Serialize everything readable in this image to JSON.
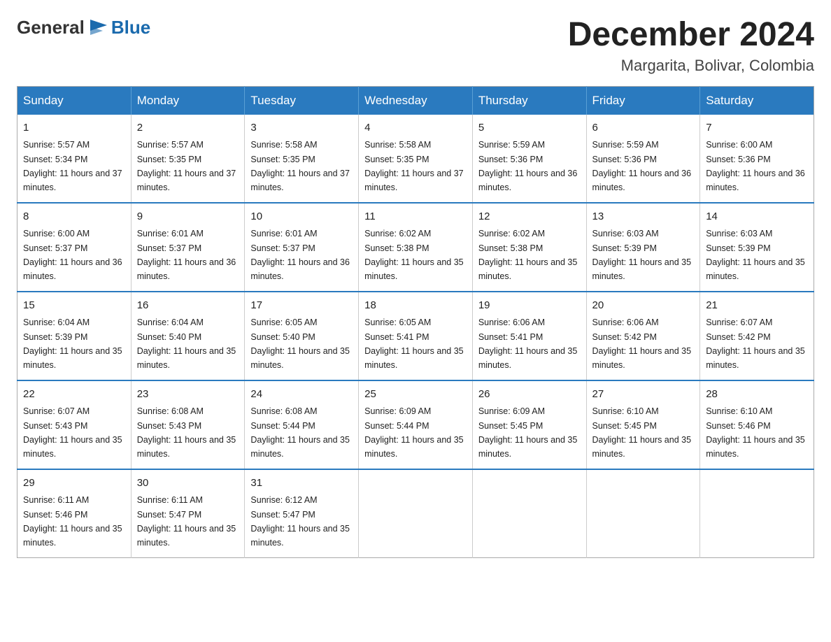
{
  "header": {
    "logo_general": "General",
    "logo_blue": "Blue",
    "month_title": "December 2024",
    "location": "Margarita, Bolivar, Colombia"
  },
  "days_of_week": [
    "Sunday",
    "Monday",
    "Tuesday",
    "Wednesday",
    "Thursday",
    "Friday",
    "Saturday"
  ],
  "weeks": [
    [
      {
        "num": "1",
        "sunrise": "5:57 AM",
        "sunset": "5:34 PM",
        "daylight": "11 hours and 37 minutes."
      },
      {
        "num": "2",
        "sunrise": "5:57 AM",
        "sunset": "5:35 PM",
        "daylight": "11 hours and 37 minutes."
      },
      {
        "num": "3",
        "sunrise": "5:58 AM",
        "sunset": "5:35 PM",
        "daylight": "11 hours and 37 minutes."
      },
      {
        "num": "4",
        "sunrise": "5:58 AM",
        "sunset": "5:35 PM",
        "daylight": "11 hours and 37 minutes."
      },
      {
        "num": "5",
        "sunrise": "5:59 AM",
        "sunset": "5:36 PM",
        "daylight": "11 hours and 36 minutes."
      },
      {
        "num": "6",
        "sunrise": "5:59 AM",
        "sunset": "5:36 PM",
        "daylight": "11 hours and 36 minutes."
      },
      {
        "num": "7",
        "sunrise": "6:00 AM",
        "sunset": "5:36 PM",
        "daylight": "11 hours and 36 minutes."
      }
    ],
    [
      {
        "num": "8",
        "sunrise": "6:00 AM",
        "sunset": "5:37 PM",
        "daylight": "11 hours and 36 minutes."
      },
      {
        "num": "9",
        "sunrise": "6:01 AM",
        "sunset": "5:37 PM",
        "daylight": "11 hours and 36 minutes."
      },
      {
        "num": "10",
        "sunrise": "6:01 AM",
        "sunset": "5:37 PM",
        "daylight": "11 hours and 36 minutes."
      },
      {
        "num": "11",
        "sunrise": "6:02 AM",
        "sunset": "5:38 PM",
        "daylight": "11 hours and 35 minutes."
      },
      {
        "num": "12",
        "sunrise": "6:02 AM",
        "sunset": "5:38 PM",
        "daylight": "11 hours and 35 minutes."
      },
      {
        "num": "13",
        "sunrise": "6:03 AM",
        "sunset": "5:39 PM",
        "daylight": "11 hours and 35 minutes."
      },
      {
        "num": "14",
        "sunrise": "6:03 AM",
        "sunset": "5:39 PM",
        "daylight": "11 hours and 35 minutes."
      }
    ],
    [
      {
        "num": "15",
        "sunrise": "6:04 AM",
        "sunset": "5:39 PM",
        "daylight": "11 hours and 35 minutes."
      },
      {
        "num": "16",
        "sunrise": "6:04 AM",
        "sunset": "5:40 PM",
        "daylight": "11 hours and 35 minutes."
      },
      {
        "num": "17",
        "sunrise": "6:05 AM",
        "sunset": "5:40 PM",
        "daylight": "11 hours and 35 minutes."
      },
      {
        "num": "18",
        "sunrise": "6:05 AM",
        "sunset": "5:41 PM",
        "daylight": "11 hours and 35 minutes."
      },
      {
        "num": "19",
        "sunrise": "6:06 AM",
        "sunset": "5:41 PM",
        "daylight": "11 hours and 35 minutes."
      },
      {
        "num": "20",
        "sunrise": "6:06 AM",
        "sunset": "5:42 PM",
        "daylight": "11 hours and 35 minutes."
      },
      {
        "num": "21",
        "sunrise": "6:07 AM",
        "sunset": "5:42 PM",
        "daylight": "11 hours and 35 minutes."
      }
    ],
    [
      {
        "num": "22",
        "sunrise": "6:07 AM",
        "sunset": "5:43 PM",
        "daylight": "11 hours and 35 minutes."
      },
      {
        "num": "23",
        "sunrise": "6:08 AM",
        "sunset": "5:43 PM",
        "daylight": "11 hours and 35 minutes."
      },
      {
        "num": "24",
        "sunrise": "6:08 AM",
        "sunset": "5:44 PM",
        "daylight": "11 hours and 35 minutes."
      },
      {
        "num": "25",
        "sunrise": "6:09 AM",
        "sunset": "5:44 PM",
        "daylight": "11 hours and 35 minutes."
      },
      {
        "num": "26",
        "sunrise": "6:09 AM",
        "sunset": "5:45 PM",
        "daylight": "11 hours and 35 minutes."
      },
      {
        "num": "27",
        "sunrise": "6:10 AM",
        "sunset": "5:45 PM",
        "daylight": "11 hours and 35 minutes."
      },
      {
        "num": "28",
        "sunrise": "6:10 AM",
        "sunset": "5:46 PM",
        "daylight": "11 hours and 35 minutes."
      }
    ],
    [
      {
        "num": "29",
        "sunrise": "6:11 AM",
        "sunset": "5:46 PM",
        "daylight": "11 hours and 35 minutes."
      },
      {
        "num": "30",
        "sunrise": "6:11 AM",
        "sunset": "5:47 PM",
        "daylight": "11 hours and 35 minutes."
      },
      {
        "num": "31",
        "sunrise": "6:12 AM",
        "sunset": "5:47 PM",
        "daylight": "11 hours and 35 minutes."
      },
      null,
      null,
      null,
      null
    ]
  ]
}
